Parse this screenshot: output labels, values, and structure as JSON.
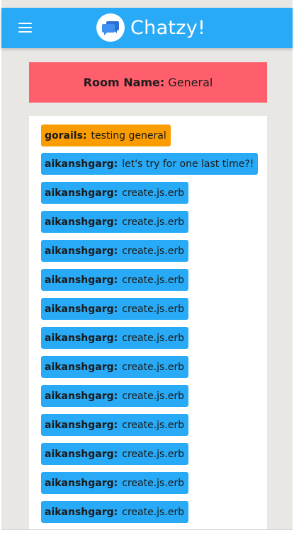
{
  "navbar": {
    "menu_icon": "hamburger-menu-icon",
    "logo_icon": "chat-bubbles-icon",
    "brand": "Chatzy!",
    "color": "#28aaf6"
  },
  "room": {
    "label": "Room Name:",
    "name": "General",
    "color": "#ff5e6c"
  },
  "messages": [
    {
      "user": "gorails:",
      "text": "testing general",
      "color": "#fb9c00"
    },
    {
      "user": "aikanshgarg:",
      "text": "let's try for one last time?!",
      "color": "#28aaf6"
    },
    {
      "user": "aikanshgarg:",
      "text": "create.js.erb",
      "color": "#28aaf6"
    },
    {
      "user": "aikanshgarg:",
      "text": "create.js.erb",
      "color": "#28aaf6"
    },
    {
      "user": "aikanshgarg:",
      "text": "create.js.erb",
      "color": "#28aaf6"
    },
    {
      "user": "aikanshgarg:",
      "text": "create.js.erb",
      "color": "#28aaf6"
    },
    {
      "user": "aikanshgarg:",
      "text": "create.js.erb",
      "color": "#28aaf6"
    },
    {
      "user": "aikanshgarg:",
      "text": "create.js.erb",
      "color": "#28aaf6"
    },
    {
      "user": "aikanshgarg:",
      "text": "create.js.erb",
      "color": "#28aaf6"
    },
    {
      "user": "aikanshgarg:",
      "text": "create.js.erb",
      "color": "#28aaf6"
    },
    {
      "user": "aikanshgarg:",
      "text": "create.js.erb",
      "color": "#28aaf6"
    },
    {
      "user": "aikanshgarg:",
      "text": "create.js.erb",
      "color": "#28aaf6"
    },
    {
      "user": "aikanshgarg:",
      "text": "create.js.erb",
      "color": "#28aaf6"
    },
    {
      "user": "aikanshgarg:",
      "text": "create.js.erb",
      "color": "#28aaf6"
    }
  ]
}
